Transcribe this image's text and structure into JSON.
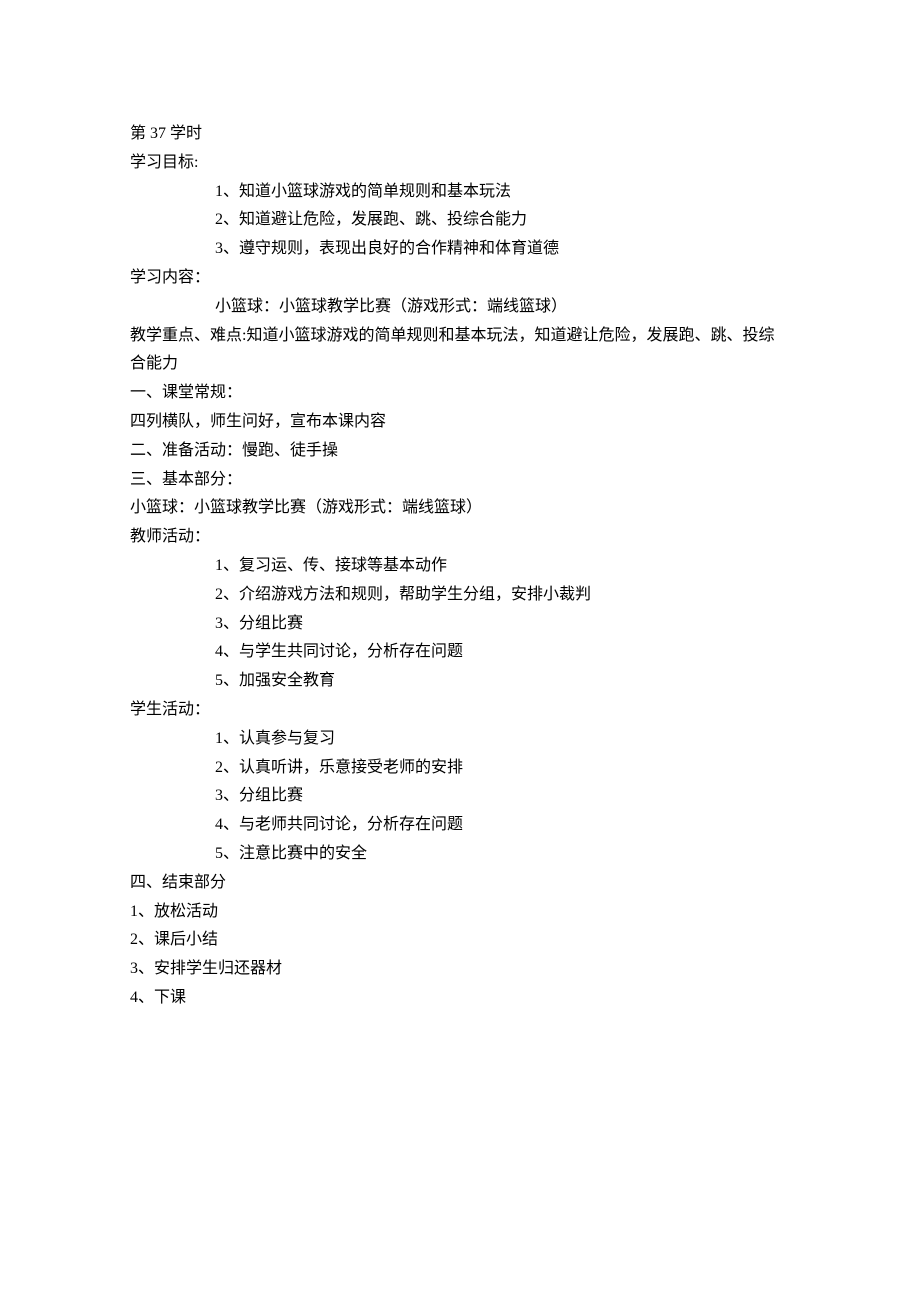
{
  "header": {
    "lesson_number": "第 37 学时",
    "objectives_label": "学习目标:"
  },
  "objectives": [
    "1、知道小篮球游戏的简单规则和基本玩法",
    "2、知道避让危险，发展跑、跳、投综合能力",
    "3、遵守规则，表现出良好的合作精神和体育道德"
  ],
  "content_label": "学习内容：",
  "content_text": "小篮球：小篮球教学比赛（游戏形式：端线篮球）",
  "keypoints_line1": "教学重点、难点:知道小篮球游戏的简单规则和基本玩法，知道避让危险，发展跑、跳、投综",
  "keypoints_line2": "合能力",
  "sections": {
    "s1_title": "一、课堂常规：",
    "s1_body": "四列横队，师生问好，宣布本课内容",
    "s2_title": "二、准备活动：慢跑、徒手操",
    "s3_title": "三、基本部分：",
    "s3_body": "小篮球：小篮球教学比赛（游戏形式：端线篮球）",
    "teacher_label": "教师活动：",
    "teacher_items": [
      "1、复习运、传、接球等基本动作",
      "2、介绍游戏方法和规则，帮助学生分组，安排小裁判",
      "3、分组比赛",
      "4、与学生共同讨论，分析存在问题",
      "5、加强安全教育"
    ],
    "student_label": "学生活动：",
    "student_items": [
      "1、认真参与复习",
      "2、认真听讲，乐意接受老师的安排",
      "3、分组比赛",
      "4、与老师共同讨论，分析存在问题",
      "5、注意比赛中的安全"
    ],
    "s4_title": "四、结束部分",
    "s4_items": [
      "1、放松活动",
      "2、课后小结",
      "3、安排学生归还器材",
      "4、下课"
    ]
  }
}
